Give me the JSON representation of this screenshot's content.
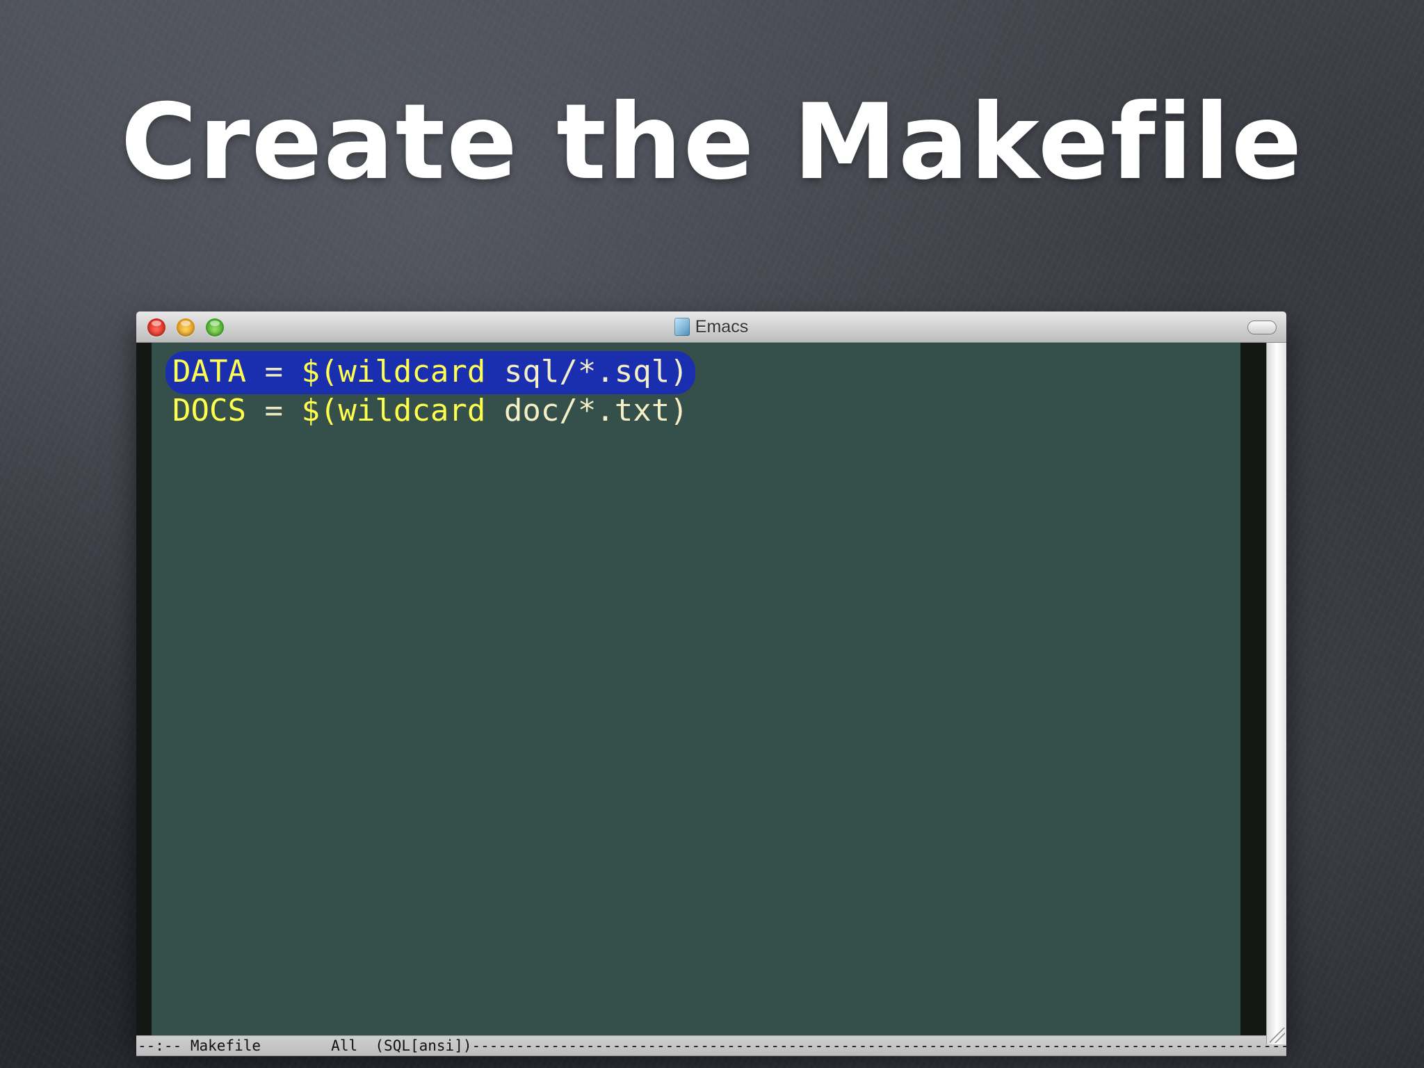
{
  "slide": {
    "title": "Create the Makefile"
  },
  "window": {
    "title": "Emacs",
    "app_icon": "emacs-document-icon",
    "buttons": {
      "close": "close-button",
      "minimize": "minimize-button",
      "zoom": "zoom-button"
    }
  },
  "editor": {
    "lines": [
      {
        "var": "DATA",
        "op": " = ",
        "fn": "$(wildcard ",
        "arg": "sql/*.sql",
        "close": ")"
      },
      {
        "var": "DOCS",
        "op": " = ",
        "fn": "$(wildcard ",
        "arg": "doc/*.txt",
        "close": ")"
      }
    ]
  },
  "modeline": {
    "status": "--:-- ",
    "buffer": "Makefile",
    "gap": "        ",
    "position": "All",
    "gap2": "  ",
    "mode": "(SQL[ansi])",
    "fill": "---------------------------------------------------------------------------------------------------------------------------"
  },
  "colors": {
    "editor_bg": "#354f4a",
    "region_bg": "#1a2fb0",
    "keyword_yellow": "#ffff4f"
  }
}
